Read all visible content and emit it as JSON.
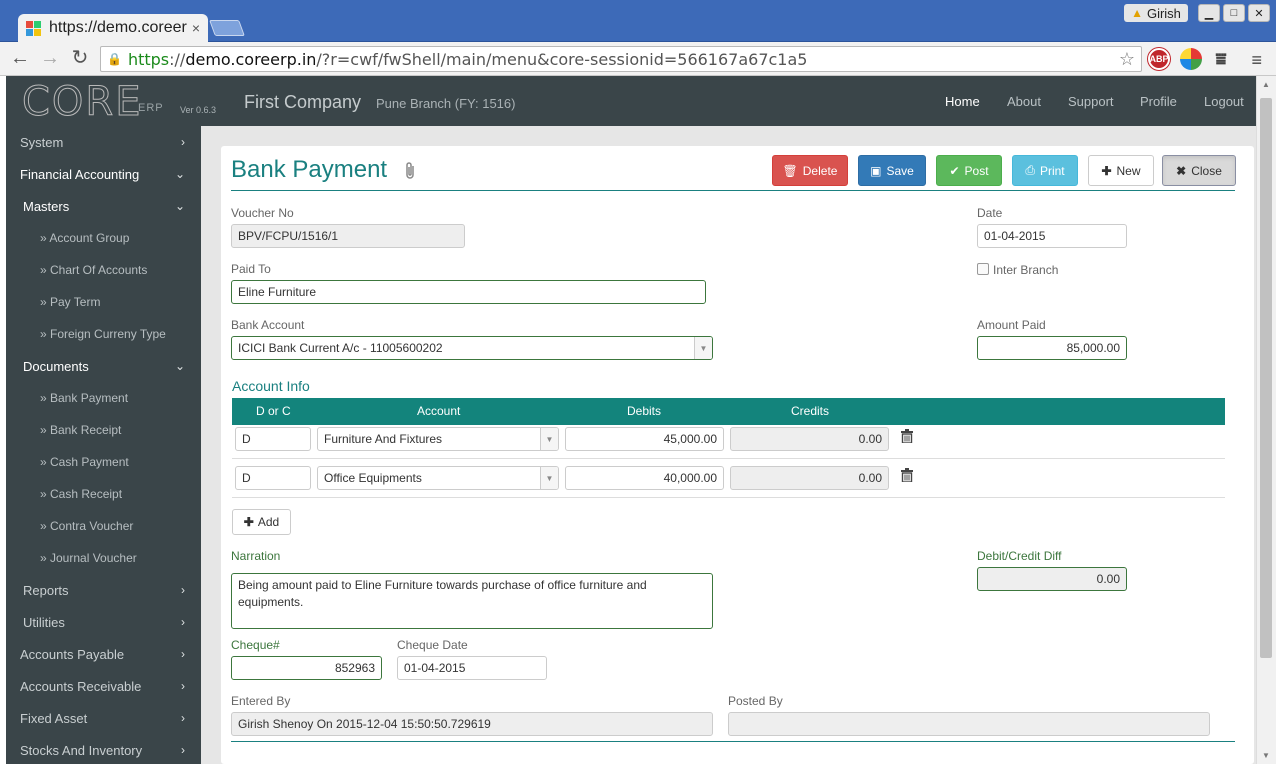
{
  "browser": {
    "tab_title": "https://demo.coreer",
    "tab_close": "×",
    "user": "Girish",
    "url_scheme": "https",
    "url_sep": "://",
    "url_domain": "demo.coreerp.in",
    "url_path": "/?r=cwf/fwShell/main/menu&core-sessionid=566167a67c1a5",
    "abp_label": "ABP"
  },
  "app": {
    "logo": "CORE",
    "logo_sub": "ERP",
    "version": "Ver 0.6.3",
    "company": "First Company",
    "branch": "Pune Branch (FY: 1516)",
    "nav": [
      "Home",
      "About",
      "Support",
      "Profile",
      "Logout"
    ]
  },
  "sidebar": {
    "items": [
      {
        "label": "System",
        "chev": "›"
      },
      {
        "label": "Financial Accounting",
        "chev": "⌄"
      },
      {
        "label": "Masters",
        "chev": "⌄"
      },
      {
        "label": "» Account Group"
      },
      {
        "label": "» Chart Of Accounts"
      },
      {
        "label": "» Pay Term"
      },
      {
        "label": "» Foreign Curreny Type"
      },
      {
        "label": "Documents",
        "chev": "⌄"
      },
      {
        "label": "» Bank Payment"
      },
      {
        "label": "» Bank Receipt"
      },
      {
        "label": "» Cash Payment"
      },
      {
        "label": "» Cash Receipt"
      },
      {
        "label": "» Contra Voucher"
      },
      {
        "label": "» Journal Voucher"
      },
      {
        "label": "Reports",
        "chev": "›"
      },
      {
        "label": "Utilities",
        "chev": "›"
      },
      {
        "label": "Accounts Payable",
        "chev": "›"
      },
      {
        "label": "Accounts Receivable",
        "chev": "›"
      },
      {
        "label": "Fixed Asset",
        "chev": "›"
      },
      {
        "label": "Stocks And Inventory",
        "chev": "›"
      }
    ]
  },
  "form": {
    "title": "Bank Payment",
    "buttons": {
      "delete": "Delete",
      "save": "Save",
      "post": "Post",
      "print": "Print",
      "new": "New",
      "close": "Close"
    },
    "voucher_no_label": "Voucher No",
    "voucher_no": "BPV/FCPU/1516/1",
    "date_label": "Date",
    "date": "01-04-2015",
    "paid_to_label": "Paid To",
    "paid_to": "Eline Furniture",
    "inter_branch_label": "Inter Branch",
    "bank_account_label": "Bank Account",
    "bank_account": "ICICI Bank Current A/c - 11005600202",
    "amount_paid_label": "Amount Paid",
    "amount_paid": "85,000.00",
    "account_info_label": "Account Info",
    "columns": [
      "D or C",
      "Account",
      "Debits",
      "Credits"
    ],
    "rows": [
      {
        "dc": "D",
        "account": "Furniture And Fixtures",
        "debit": "45,000.00",
        "credit": "0.00"
      },
      {
        "dc": "D",
        "account": "Office Equipments",
        "debit": "40,000.00",
        "credit": "0.00"
      }
    ],
    "add_label": "Add",
    "narration_label": "Narration",
    "narration": "Being amount paid to Eline Furniture towards purchase of office furniture and equipments.",
    "diff_label": "Debit/Credit Diff",
    "diff": "0.00",
    "cheque_label": "Cheque#",
    "cheque": "852963",
    "cheque_date_label": "Cheque Date",
    "cheque_date": "01-04-2015",
    "entered_by_label": "Entered By",
    "entered_by": "Girish Shenoy On 2015-12-04 15:50:50.729619",
    "posted_by_label": "Posted By",
    "posted_by": ""
  }
}
